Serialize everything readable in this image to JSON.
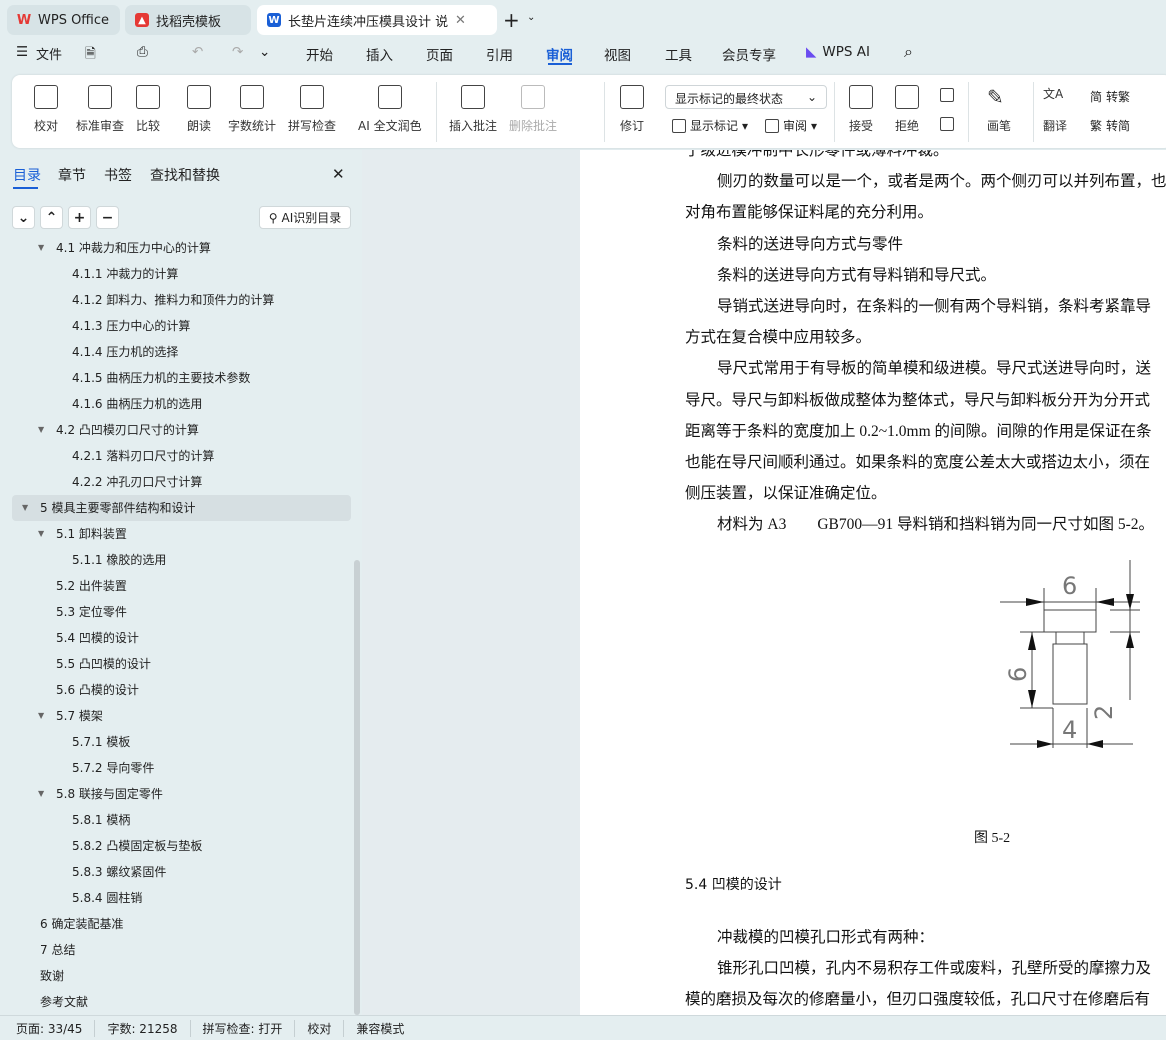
{
  "tabs": [
    {
      "label": "WPS Office"
    },
    {
      "label": "找稻壳模板"
    },
    {
      "label": "长垫片连续冲压模具设计 说明"
    }
  ],
  "menu": {
    "file": "文件",
    "items": [
      "开始",
      "插入",
      "页面",
      "引用",
      "审阅",
      "视图",
      "工具",
      "会员专享"
    ],
    "active": "审阅",
    "wps_ai": "WPS AI"
  },
  "ribbon": {
    "buttons": [
      "校对",
      "标准审查",
      "比较",
      "朗读",
      "字数统计",
      "拼写检查",
      "AI 全文润色",
      "插入批注",
      "删除批注"
    ],
    "markup_select": "显示标记的最终状态",
    "revise": "修订",
    "show_markup": "显示标记",
    "review": "审阅",
    "accept": "接受",
    "reject": "拒绝",
    "pen": "画笔",
    "translate": "翻译",
    "to_trad": "转繁",
    "to_simp": "转简"
  },
  "panel": {
    "tabs": [
      "目录",
      "章节",
      "书签",
      "查找和替换"
    ],
    "active": "目录",
    "ai_button": "AI识别目录",
    "toc": [
      {
        "label": "4.1   冲裁力和压力中心的计算",
        "level": 2,
        "expanded": true
      },
      {
        "label": "4.1.1   冲裁力的计算",
        "level": 3
      },
      {
        "label": "4.1.2  卸料力、推料力和顶件力的计算",
        "level": 3
      },
      {
        "label": "4.1.3  压力中心的计算",
        "level": 3
      },
      {
        "label": "4.1.4 压力机的选择",
        "level": 3
      },
      {
        "label": "4.1.5  曲柄压力机的主要技术参数",
        "level": 3
      },
      {
        "label": "4.1.6 曲柄压力机的选用",
        "level": 3
      },
      {
        "label": "4.2  凸凹模刃口尺寸的计算",
        "level": 2,
        "expanded": true
      },
      {
        "label": "4.2.1  落料刃口尺寸的计算",
        "level": 3
      },
      {
        "label": "4.2.2  冲孔刃口尺寸计算",
        "level": 3
      },
      {
        "label": "5    模具主要零部件结构和设计",
        "level": 1,
        "expanded": true,
        "selected": true
      },
      {
        "label": "5.1    卸料装置",
        "level": 2,
        "expanded": true
      },
      {
        "label": "5.1.1    橡胶的选用",
        "level": 3
      },
      {
        "label": "5.2    出件装置",
        "level": 2
      },
      {
        "label": "5.3    定位零件",
        "level": 2
      },
      {
        "label": "5.4    凹模的设计",
        "level": 2
      },
      {
        "label": "5.5    凸凹模的设计",
        "level": 2
      },
      {
        "label": "5.6    凸模的设计",
        "level": 2
      },
      {
        "label": "5.7    模架",
        "level": 2,
        "expanded": true
      },
      {
        "label": "5.7.1    模板",
        "level": 3
      },
      {
        "label": "5.7.2    导向零件",
        "level": 3
      },
      {
        "label": "5.8    联接与固定零件",
        "level": 2,
        "expanded": true
      },
      {
        "label": "5.8.1    模柄",
        "level": 3
      },
      {
        "label": "5.8.2    凸模固定板与垫板",
        "level": 3
      },
      {
        "label": "5.8.3    螺纹紧固件",
        "level": 3
      },
      {
        "label": "5.8.4    圆柱销",
        "level": 3
      },
      {
        "label": "6    确定装配基准",
        "level": 1
      },
      {
        "label": "7    总结",
        "level": 1
      },
      {
        "label": "致谢",
        "level": 1
      },
      {
        "label": "参考文献",
        "level": 1
      }
    ]
  },
  "document": {
    "lines": [
      {
        "text": "于级进模冲制中长形零件或薄料冲裁。",
        "indent": false
      },
      {
        "text": "侧刃的数量可以是一个，或者是两个。两个侧刃可以并列布置，也",
        "indent": true
      },
      {
        "text": "对角布置能够保证料尾的充分利用。",
        "indent": false
      },
      {
        "text": "条料的送进导向方式与零件",
        "indent": true
      },
      {
        "text": "条料的送进导向方式有导料销和导尺式。",
        "indent": true
      },
      {
        "text": "导销式送进导向时，在条料的一侧有两个导料销，条料考紧靠导",
        "indent": true
      },
      {
        "text": "方式在复合模中应用较多。",
        "indent": false
      },
      {
        "text": "导尺式常用于有导板的简单模和级进模。导尺式送进导向时，送",
        "indent": true
      },
      {
        "text": "导尺。导尺与卸料板做成整体为整体式，导尺与卸料板分开为分开式",
        "indent": false
      },
      {
        "text": "距离等于条料的宽度加上 0.2~1.0mm 的间隙。间隙的作用是保证在条",
        "indent": false
      },
      {
        "text": "也能在导尺间顺利通过。如果条料的宽度公差太大或搭边太小，须在",
        "indent": false
      },
      {
        "text": "侧压装置，以保证准确定位。",
        "indent": false
      },
      {
        "text": "材料为 A3　　GB700—91 导料销和挡料销为同一尺寸如图 5-2。",
        "indent": true
      }
    ],
    "figure": {
      "dims": [
        "6",
        "6",
        "4",
        "2"
      ],
      "caption": "图 5-2"
    },
    "heading": "5.4   凹模的设计",
    "lines2": [
      {
        "text": "冲裁模的凹模孔口形式有两种：",
        "indent": true
      },
      {
        "text": "锥形孔口凹模，孔内不易积存工件或废料，孔壁所受的摩擦力及",
        "indent": true
      },
      {
        "text": "模的磨损及每次的修磨量小，但刃口强度较低，孔口尺寸在修磨后有",
        "indent": false
      }
    ]
  },
  "status": {
    "page": "页面: 33/45",
    "words": "字数: 21258",
    "spell": "拼写检查: 打开",
    "proof": "校对",
    "compat": "兼容模式"
  },
  "colors": {
    "accent": "#1a5fd6",
    "bg": "#e4eef0",
    "wps_red": "#e53935"
  }
}
